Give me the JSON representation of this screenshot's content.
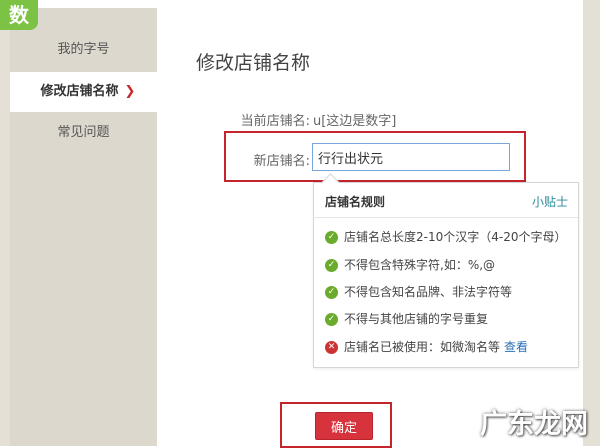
{
  "corner_badge": "数学",
  "sidebar": {
    "items": [
      {
        "label": "我的字号"
      },
      {
        "label": "修改店铺名称",
        "arrow": "❯"
      },
      {
        "label": "常见问题"
      }
    ]
  },
  "main": {
    "title": "修改店铺名称",
    "current_label": "当前店铺名:",
    "current_value": "u[这边是数字]",
    "new_label": "新店铺名:",
    "new_value": "行行出状元"
  },
  "tips": {
    "title": "店铺名规则",
    "link": "小贴士",
    "rules": [
      {
        "status": "ok",
        "icon": "check-icon",
        "text": "店铺名总长度2-10个汉字（4-20个字母）"
      },
      {
        "status": "ok",
        "icon": "check-icon",
        "text": "不得包含特殊字符,如：%,@"
      },
      {
        "status": "ok",
        "icon": "check-icon",
        "text": "不得包含知名品牌、非法字符等"
      },
      {
        "status": "ok",
        "icon": "check-icon",
        "text": "不得与其他店铺的字号重复"
      },
      {
        "status": "error",
        "icon": "cross-icon",
        "text": "店铺名已被使用：如微淘名等",
        "link": "查看"
      }
    ]
  },
  "confirm_label": "确定",
  "watermark": "广东龙网",
  "colors": {
    "accent_red": "#d7333c",
    "highlight_red": "#c4242b",
    "ok_green": "#6aaa2c",
    "link_teal": "#2a8a9a",
    "sidebar_bg": "#dcd8cd"
  }
}
